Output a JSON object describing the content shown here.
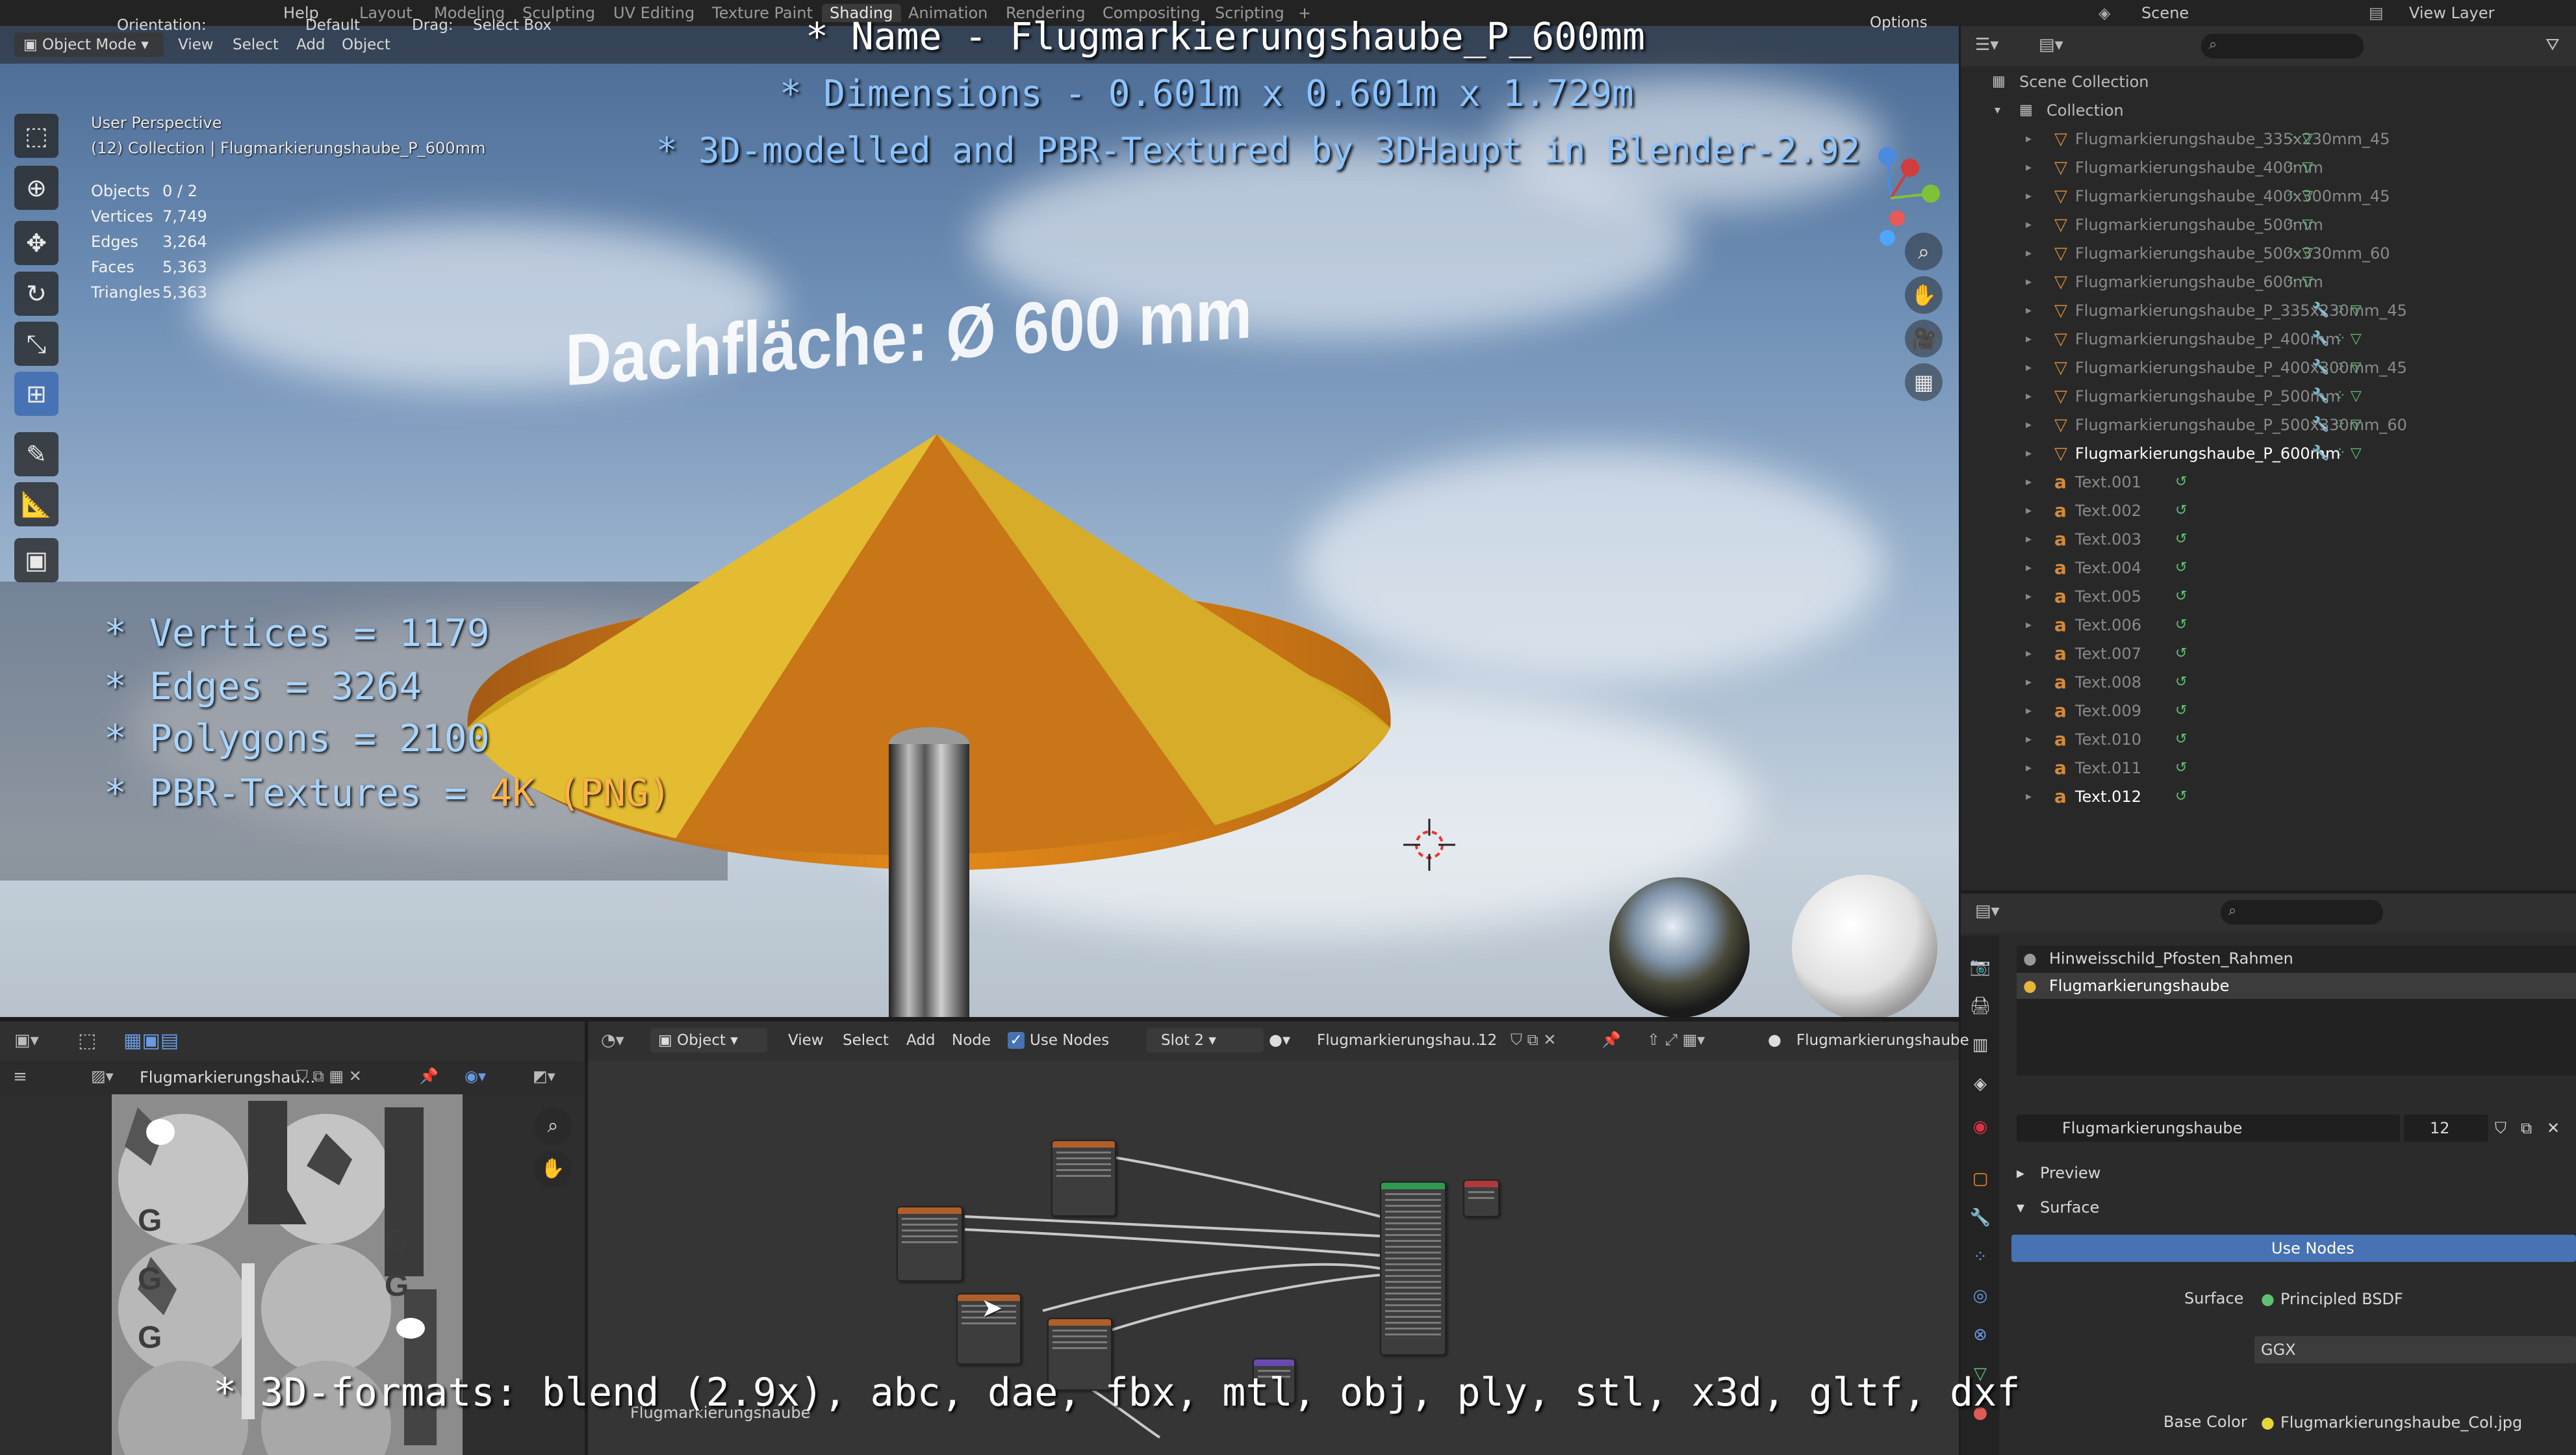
{
  "topbar": {
    "menu": [
      "Help"
    ],
    "workspaces": [
      "Layout",
      "Modeling",
      "Sculpting",
      "UV Editing",
      "Texture Paint",
      "Shading",
      "Animation",
      "Rendering",
      "Compositing",
      "Scripting"
    ],
    "active_workspace": "Shading",
    "scene": "Scene",
    "view_layer": "View Layer"
  },
  "viewport": {
    "header": {
      "mode": "Object Mode",
      "menus": [
        "View",
        "Select",
        "Add",
        "Object"
      ],
      "orientation_label": "Orientation:",
      "orientation": "Default",
      "drag_label": "Drag:",
      "drag": "Select Box",
      "options": "Options"
    },
    "perspective": "User Perspective",
    "collection": "(12) Collection | Flugmarkierungshaube_P_600mm",
    "stats": [
      {
        "label": "Objects",
        "value": "0 / 2"
      },
      {
        "label": "Vertices",
        "value": "7,749"
      },
      {
        "label": "Edges",
        "value": "3,264"
      },
      {
        "label": "Faces",
        "value": "5,363"
      },
      {
        "label": "Triangles",
        "value": "5,363"
      }
    ],
    "scene_text": "Dachfläche:  Ø 600 mm"
  },
  "overlay": {
    "name_line": "* Name - Flugmarkierungshaube_P_600mm",
    "dims_line": "* Dimensions -  0.601m x 0.601m x 1.729m",
    "credit_line": "* 3D-modelled and PBR-Textured by 3DHaupt in Blender-2.92",
    "vertices": "* Vertices = 1179",
    "edges": "* Edges = 3264",
    "polygons": "* Polygons = 2100",
    "pbr_prefix": "* PBR-Textures = ",
    "pbr_value": "4K (PNG)",
    "formats": "* 3D-formats: blend (2.9x), abc, dae, fbx, mtl, obj, ply, stl, x3d, gltf, dxf"
  },
  "outliner": {
    "scene_collection": "Scene Collection",
    "collection": "Collection",
    "objects": [
      "Flugmarkierungshaube_335x230mm_45",
      "Flugmarkierungshaube_400mm",
      "Flugmarkierungshaube_400x300mm_45",
      "Flugmarkierungshaube_500mm",
      "Flugmarkierungshaube_500x330mm_60",
      "Flugmarkierungshaube_600mm",
      "Flugmarkierungshaube_P_335x230mm_45",
      "Flugmarkierungshaube_P_400mm",
      "Flugmarkierungshaube_P_400x300mm_45",
      "Flugmarkierungshaube_P_500mm",
      "Flugmarkierungshaube_P_500x330mm_60",
      "Flugmarkierungshaube_P_600mm"
    ],
    "texts": [
      "Text.001",
      "Text.002",
      "Text.003",
      "Text.004",
      "Text.005",
      "Text.006",
      "Text.007",
      "Text.008",
      "Text.009",
      "Text.010",
      "Text.011",
      "Text.012"
    ]
  },
  "properties": {
    "materials": [
      "Hinweisschild_Pfosten_Rahmen",
      "Flugmarkierungshaube"
    ],
    "material_name": "Flugmarkierungshaube",
    "users": "12",
    "preview": "Preview",
    "surface_section": "Surface",
    "use_nodes": "Use Nodes",
    "surface_label": "Surface",
    "surface_value": "Principled BSDF",
    "distribution": "GGX",
    "base_color_label": "Base Color",
    "base_color_value": "Flugmarkierungshaube_Col.jpg"
  },
  "image_editor": {
    "image_name": "Flugmarkierungshau..."
  },
  "node_editor": {
    "object": "Object",
    "menus": [
      "View",
      "Select",
      "Add",
      "Node"
    ],
    "use_nodes": "Use Nodes",
    "slot": "Slot 2",
    "material": "Flugmarkierungshau...",
    "users": "12",
    "breadcrumb": "Flugmarkierungshaube",
    "frame_label": "Flugmarkierungshaube"
  },
  "colors": {
    "accent": "#4772b3",
    "object_icon": "#d48a3a",
    "mesh_data": "#5fbf74",
    "cone": "#e2b52c"
  }
}
